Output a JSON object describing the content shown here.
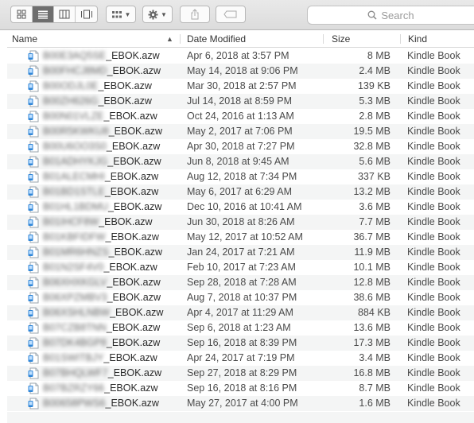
{
  "toolbar": {
    "views": [
      {
        "name": "icon-view-icon"
      },
      {
        "name": "list-view-icon"
      },
      {
        "name": "column-view-icon"
      },
      {
        "name": "cover-flow-icon"
      }
    ],
    "arrange_icon": "grid-icon",
    "action_icon": "gear-icon",
    "share_icon": "share-icon",
    "tag_icon": "tag-icon",
    "search_placeholder": "Search"
  },
  "columns": {
    "name": "Name",
    "date": "Date Modified",
    "size": "Size",
    "kind": "Kind"
  },
  "files": [
    {
      "prefix": "B00E3AQ5SE",
      "suffix": "_EBOK.azw",
      "date": "Apr 6, 2018 at 3:57 PM",
      "size": "8 MB",
      "kind": "Kindle Book"
    },
    {
      "prefix": "B00FHCJ8MD",
      "suffix": "_EBOK.azw",
      "date": "May 14, 2018 at 9:06 PM",
      "size": "2.4 MB",
      "kind": "Kindle Book"
    },
    {
      "prefix": "B00ODJL0E",
      "suffix": "_EBOK.azw",
      "date": "Mar 30, 2018 at 2:57 PM",
      "size": "139 KB",
      "kind": "Kindle Book"
    },
    {
      "prefix": "B00ZH626G",
      "suffix": "_EBOK.azw",
      "date": "Jul 14, 2018 at 8:59 PM",
      "size": "5.3 MB",
      "kind": "Kindle Book"
    },
    {
      "prefix": "B00N01VLZE",
      "suffix": "_EBOK.azw",
      "date": "Oct 24, 2016 at 1:13 AM",
      "size": "2.8 MB",
      "kind": "Kindle Book"
    },
    {
      "prefix": "B00R5KWKU8",
      "suffix": "_EBOK.azw",
      "date": "May 2, 2017 at 7:06 PM",
      "size": "19.5 MB",
      "kind": "Kindle Book"
    },
    {
      "prefix": "B00U6OO3S0",
      "suffix": "_EBOK.azw",
      "date": "Apr 30, 2018 at 7:27 PM",
      "size": "32.8 MB",
      "kind": "Kindle Book"
    },
    {
      "prefix": "B01ADHYKJG",
      "suffix": "_EBOK.azw",
      "date": "Jun 8, 2018 at 9:45 AM",
      "size": "5.6 MB",
      "kind": "Kindle Book"
    },
    {
      "prefix": "B01ALECMHI",
      "suffix": "_EBOK.azw",
      "date": "Aug 12, 2018 at 7:34 PM",
      "size": "337 KB",
      "kind": "Kindle Book"
    },
    {
      "prefix": "B01BD1STLE",
      "suffix": "_EBOK.azw",
      "date": "May 6, 2017 at 6:29 AM",
      "size": "13.2 MB",
      "kind": "Kindle Book"
    },
    {
      "prefix": "B01HL1BDMU",
      "suffix": "_EBOK.azw",
      "date": "Dec 10, 2016 at 10:41 AM",
      "size": "3.6 MB",
      "kind": "Kindle Book"
    },
    {
      "prefix": "B01IHCF8W",
      "suffix": "_EBOK.azw",
      "date": "Jun 30, 2018 at 8:26 AM",
      "size": "7.7 MB",
      "kind": "Kindle Book"
    },
    {
      "prefix": "B01KBFIDFW",
      "suffix": "_EBOK.azw",
      "date": "May 12, 2017 at 10:52 AM",
      "size": "36.7 MB",
      "kind": "Kindle Book"
    },
    {
      "prefix": "B01MR6HNZS",
      "suffix": "_EBOK.azw",
      "date": "Jan 24, 2017 at 7:21 AM",
      "size": "11.9 MB",
      "kind": "Kindle Book"
    },
    {
      "prefix": "B01N2SF4V0",
      "suffix": "_EBOK.azw",
      "date": "Feb 10, 2017 at 7:23 AM",
      "size": "10.1 MB",
      "kind": "Kindle Book"
    },
    {
      "prefix": "B06XHXKGLV",
      "suffix": "_EBOK.azw",
      "date": "Sep 28, 2018 at 7:28 AM",
      "size": "12.8 MB",
      "kind": "Kindle Book"
    },
    {
      "prefix": "B06XPZMBV3",
      "suffix": "_EBOK.azw",
      "date": "Aug 7, 2018 at 10:37 PM",
      "size": "38.6 MB",
      "kind": "Kindle Book"
    },
    {
      "prefix": "B06XSHLNBW",
      "suffix": "_EBOK.azw",
      "date": "Apr 4, 2017 at 11:29 AM",
      "size": "884 KB",
      "kind": "Kindle Book"
    },
    {
      "prefix": "B07CZB8TNN",
      "suffix": "_EBOK.azw",
      "date": "Sep 6, 2018 at 1:23 AM",
      "size": "13.6 MB",
      "kind": "Kindle Book"
    },
    {
      "prefix": "B07DK4BGP8",
      "suffix": "_EBOK.azw",
      "date": "Sep 16, 2018 at 8:39 PM",
      "size": "17.3 MB",
      "kind": "Kindle Book"
    },
    {
      "prefix": "B01SWITBJY",
      "suffix": "_EBOK.azw",
      "date": "Apr 24, 2017 at 7:19 PM",
      "size": "3.4 MB",
      "kind": "Kindle Book"
    },
    {
      "prefix": "B07BHQLWF7",
      "suffix": "_EBOK.azw",
      "date": "Sep 27, 2018 at 8:29 PM",
      "size": "16.8 MB",
      "kind": "Kindle Book"
    },
    {
      "prefix": "B07BZRZY66",
      "suffix": "_EBOK.azw",
      "date": "Sep 16, 2018 at 8:16 PM",
      "size": "8.7 MB",
      "kind": "Kindle Book"
    },
    {
      "prefix": "B00658PWS6",
      "suffix": "_EBOK.azw",
      "date": "May 27, 2017 at 4:00 PM",
      "size": "1.6 MB",
      "kind": "Kindle Book"
    }
  ]
}
